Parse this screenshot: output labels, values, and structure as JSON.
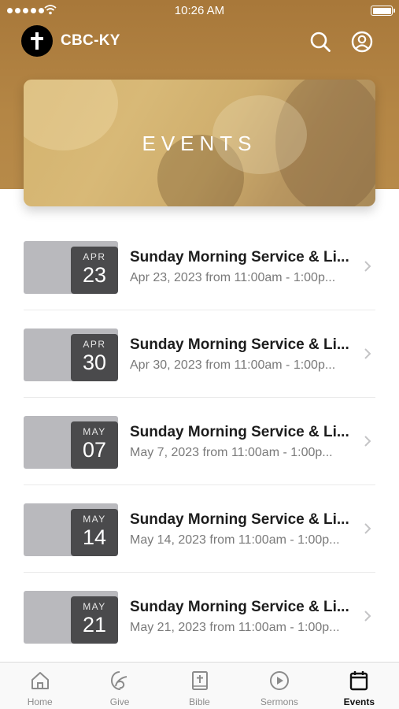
{
  "status_bar": {
    "time": "10:26 AM"
  },
  "header": {
    "title": "CBC-KY",
    "logo_icon": "cross-icon",
    "search_icon": "search-icon",
    "account_icon": "user-account-icon"
  },
  "hero": {
    "title": "EVENTS"
  },
  "events": [
    {
      "month": "APR",
      "day": "23",
      "title": "Sunday Morning Service & Li...",
      "subtitle": "Apr 23, 2023 from 11:00am - 1:00p..."
    },
    {
      "month": "APR",
      "day": "30",
      "title": "Sunday Morning Service & Li...",
      "subtitle": "Apr 30, 2023 from 11:00am - 1:00p..."
    },
    {
      "month": "MAY",
      "day": "07",
      "title": "Sunday Morning Service & Li...",
      "subtitle": "May 7, 2023 from 11:00am - 1:00p..."
    },
    {
      "month": "MAY",
      "day": "14",
      "title": "Sunday Morning Service & Li...",
      "subtitle": "May 14, 2023 from 11:00am - 1:00p..."
    },
    {
      "month": "MAY",
      "day": "21",
      "title": "Sunday Morning Service & Li...",
      "subtitle": "May 21, 2023 from 11:00am - 1:00p..."
    }
  ],
  "tab_bar": {
    "tabs": [
      {
        "label": "Home",
        "icon": "home-icon"
      },
      {
        "label": "Give",
        "icon": "give-icon"
      },
      {
        "label": "Bible",
        "icon": "bible-icon"
      },
      {
        "label": "Sermons",
        "icon": "play-circle-icon"
      },
      {
        "label": "Events",
        "icon": "calendar-icon"
      }
    ],
    "active": "Events"
  },
  "colors": {
    "header": "#b08040",
    "badge": "#4a4a4c",
    "thumb": "#b9b9bd",
    "inactive_tab": "#8b8b8b"
  }
}
